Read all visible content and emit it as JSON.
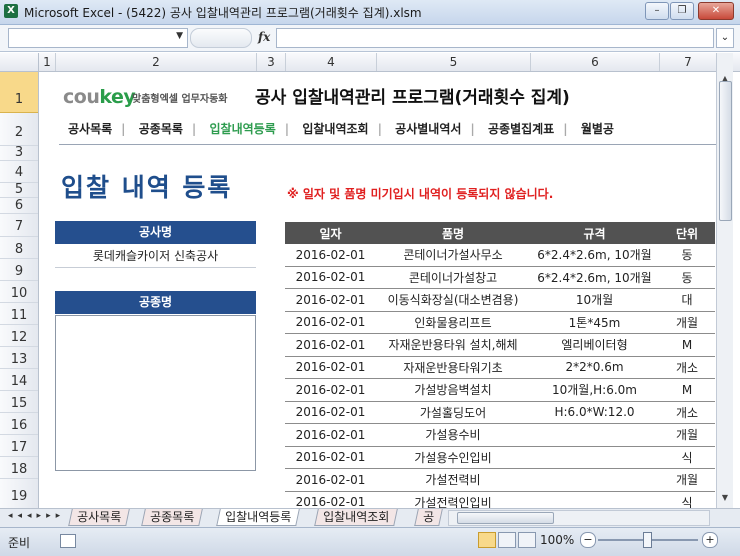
{
  "window": {
    "title": "Microsoft Excel - (5422) 공사 입찰내역관리 프로그램(거래횟수 집계).xlsm",
    "fx": "fx"
  },
  "columns": [
    "1",
    "2",
    "3",
    "4",
    "5",
    "6",
    "7"
  ],
  "rows": [
    "1",
    "2",
    "3",
    "4",
    "5",
    "6",
    "7",
    "8",
    "9",
    "10",
    "11",
    "12",
    "13",
    "14",
    "15",
    "16",
    "17",
    "18",
    "19"
  ],
  "brand": {
    "cou": "cou",
    "key": "key",
    "sub": "맞춤형엑셀 업무자동화"
  },
  "app_title": "공사 입찰내역관리 프로그램(거래횟수 집계)",
  "nav": {
    "items": [
      "공사목록",
      "공종목록",
      "입찰내역등록",
      "입찰내역조회",
      "공사별내역서",
      "공종별집계표",
      "월별공"
    ],
    "active_index": 2,
    "active_color": "#2e9c4f"
  },
  "page_title": "입찰 내역 등록",
  "warning": "※ 일자 및 품명 미기입시 내역이 등록되지 않습니다.",
  "project": {
    "label": "공사명",
    "value": "롯데캐슬카이저 신축공사"
  },
  "trade": {
    "label": "공종명"
  },
  "table": {
    "headers": [
      "일자",
      "품명",
      "규격",
      "단위"
    ],
    "rows": [
      [
        "2016-02-01",
        "콘테이너가설사무소",
        "6*2.4*2.6m, 10개월",
        "동"
      ],
      [
        "2016-02-01",
        "콘테이너가설창고",
        "6*2.4*2.6m, 10개월",
        "동"
      ],
      [
        "2016-02-01",
        "이동식화장실(대소변겸용)",
        "10개월",
        "대"
      ],
      [
        "2016-02-01",
        "인화물용리프트",
        "1톤*45m",
        "개월"
      ],
      [
        "2016-02-01",
        "자재운반용타워 설치,해체",
        "엘리베이터형",
        "M"
      ],
      [
        "2016-02-01",
        "자재운반용타워기초",
        "2*2*0.6m",
        "개소"
      ],
      [
        "2016-02-01",
        "가설방음벽설치",
        "10개월,H:6.0m",
        "M"
      ],
      [
        "2016-02-01",
        "가설홀딩도어",
        "H:6.0*W:12.0",
        "개소"
      ],
      [
        "2016-02-01",
        "가설용수비",
        "",
        "개월"
      ],
      [
        "2016-02-01",
        "가설용수인입비",
        "",
        "식"
      ],
      [
        "2016-02-01",
        "가설전력비",
        "",
        "개월"
      ],
      [
        "2016-02-01",
        "가설전력인입비",
        "",
        "식"
      ]
    ]
  },
  "sheet_tabs": [
    "공사목록",
    "공종목록",
    "입찰내역등록",
    "입찰내역조회",
    "공"
  ],
  "active_tab_index": 2,
  "status": {
    "ready": "준비",
    "zoom": "100%"
  },
  "colors": {
    "header_blue": "#254f8e",
    "title_blue": "#1f4e8c",
    "warning_red": "#e02020",
    "table_header": "#525252",
    "selected_row": "#f8d98a"
  }
}
